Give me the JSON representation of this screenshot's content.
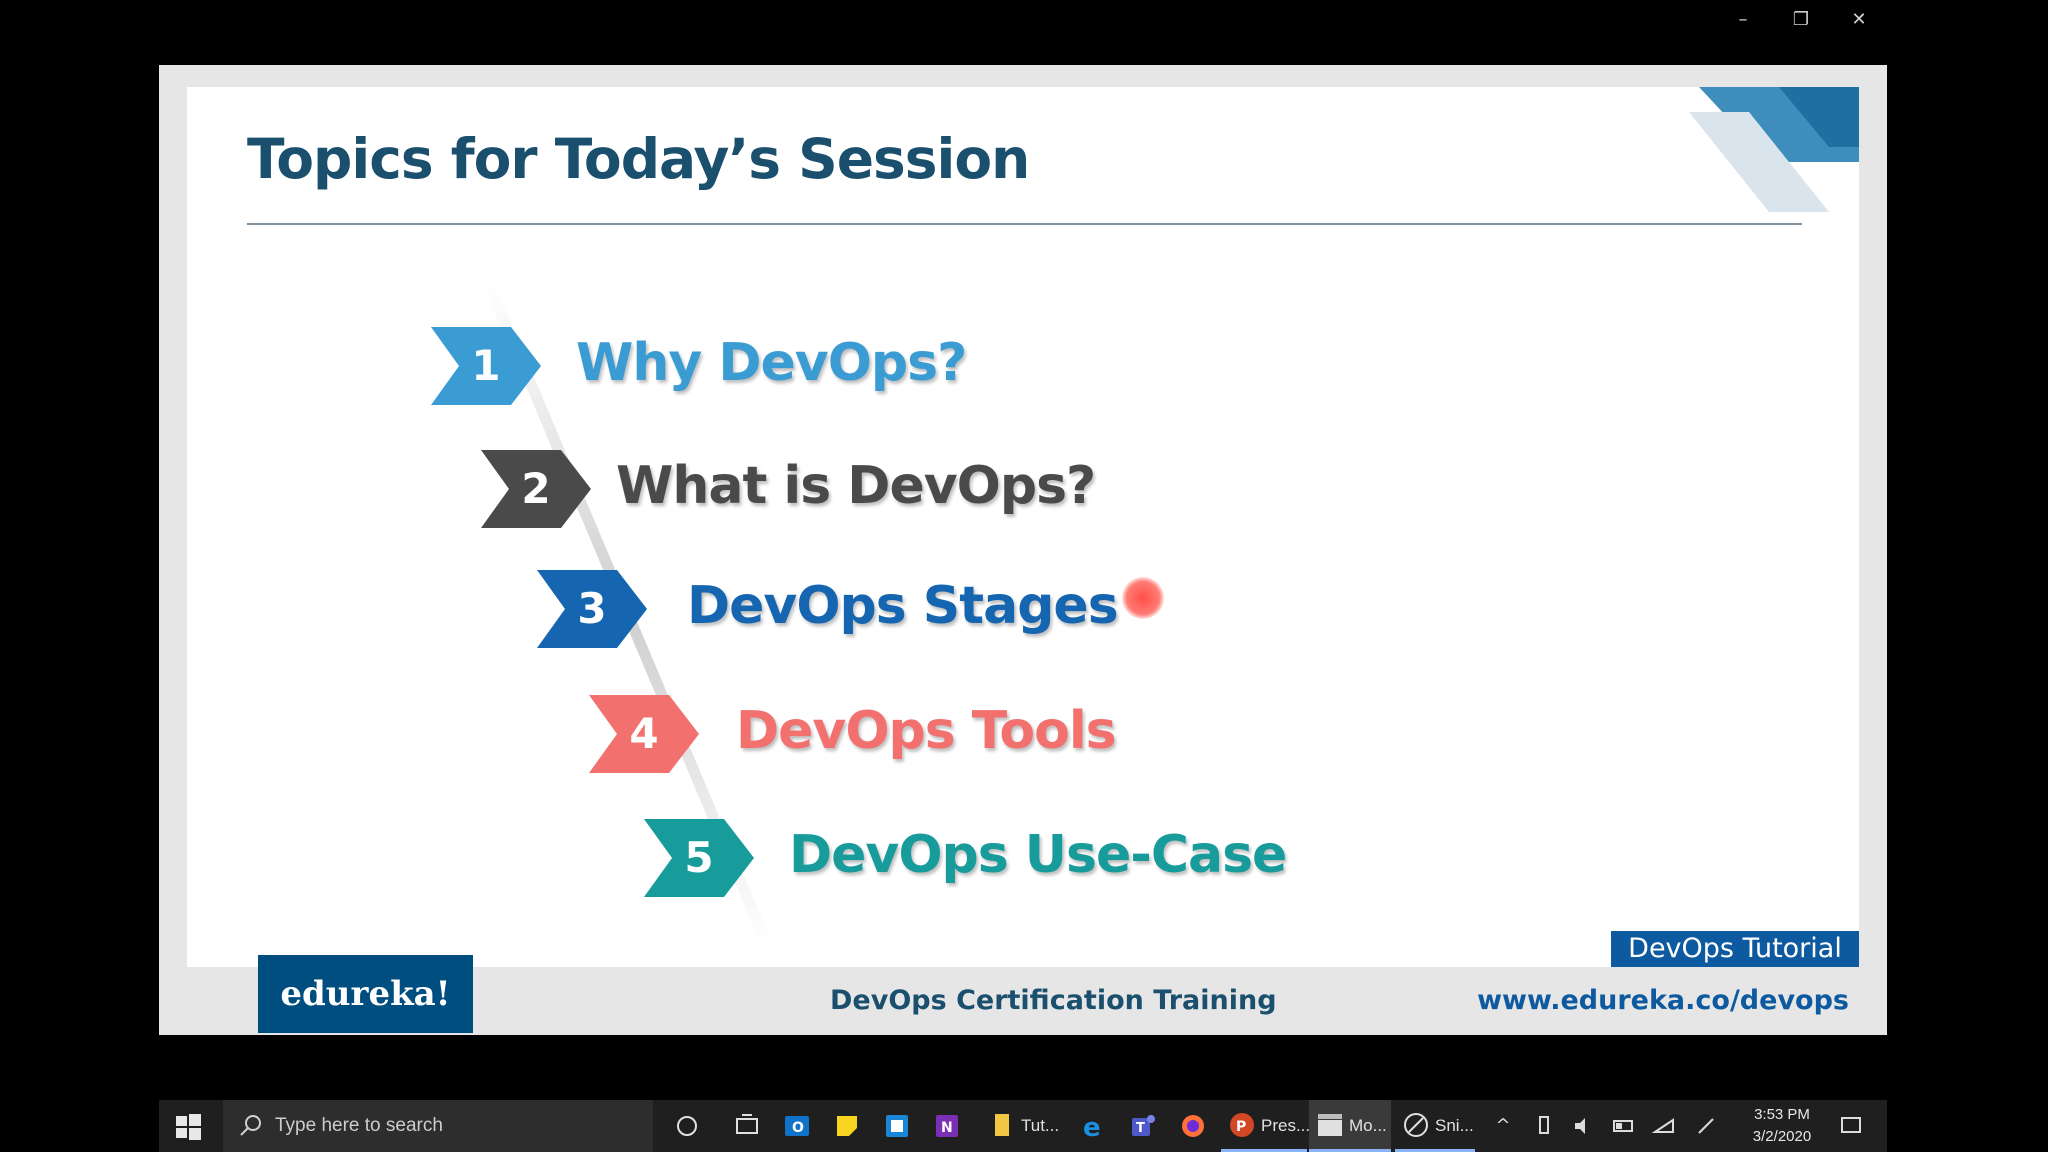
{
  "window": {
    "controls": {
      "minimize": "–",
      "restore": "❐",
      "close": "✕"
    }
  },
  "slide": {
    "title": "Topics for Today’s Session",
    "topics": [
      {
        "number": "1",
        "text": "Why DevOps?",
        "color": "#3b9bd3"
      },
      {
        "number": "2",
        "text": "What is DevOps?",
        "color": "#4a4a4a"
      },
      {
        "number": "3",
        "text": "DevOps Stages",
        "color": "#1565b0"
      },
      {
        "number": "4",
        "text": "DevOps Tools",
        "color": "#f2706e"
      },
      {
        "number": "5",
        "text": "DevOps Use-Case",
        "color": "#189b9b"
      }
    ],
    "tutorial_badge": "DevOps Tutorial",
    "footer": {
      "logo": "edureka!",
      "center": "DevOps Certification Training",
      "url": "www.edureka.co/devops"
    },
    "colors": {
      "title": "#1a4f6e",
      "logo_bg": "#004d80",
      "badge_bg": "#0d5aa0"
    }
  },
  "taskbar": {
    "search_placeholder": "Type here to search",
    "apps": [
      {
        "name": "file-explorer",
        "label": "Tut..."
      },
      {
        "name": "powerpoint",
        "label": "Pres..."
      },
      {
        "name": "movies",
        "label": "Mo..."
      },
      {
        "name": "snip",
        "label": "Sni..."
      }
    ],
    "clock": {
      "time": "3:53 PM",
      "date": "3/2/2020"
    }
  }
}
